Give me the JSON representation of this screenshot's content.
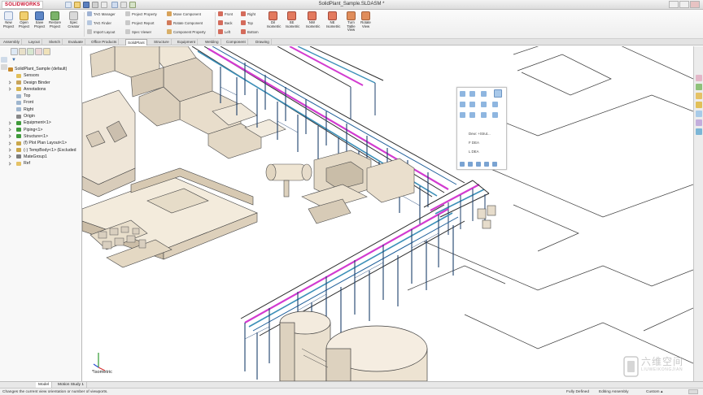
{
  "app": {
    "brand": "SOLIDWORKS",
    "window_title": "SolidPlant_Sample.SLDASM *"
  },
  "ribbon": {
    "buttons": [
      {
        "label": "New Project",
        "icon": "new-project-icon"
      },
      {
        "label": "Open Project",
        "icon": "open-project-icon"
      },
      {
        "label": "Save Project",
        "icon": "save-project-icon"
      },
      {
        "label": "Restore Project",
        "icon": "restore-project-icon"
      },
      {
        "label": "Spec Creator",
        "icon": "spec-creator-icon"
      }
    ],
    "column1": [
      "TAG Manager",
      "TAG Finder",
      "Import Layout"
    ],
    "column2": [
      "Project Property",
      "Project Report",
      "Spec Viewer"
    ],
    "column3": [
      "Move Component",
      "Rotate Component",
      "Component Property"
    ],
    "view_list1": [
      "Front",
      "Back",
      "Left"
    ],
    "view_list2": [
      "Right",
      "Top",
      "Bottom"
    ],
    "view_buttons": [
      {
        "label": "Dil Isometric"
      },
      {
        "label": "SE Isometric"
      },
      {
        "label": "NW Isometric"
      },
      {
        "label": "NE Isometric"
      },
      {
        "label": "Turn Table View"
      },
      {
        "label": "Rotate View"
      }
    ]
  },
  "command_tabs": [
    "Assembly",
    "Layout",
    "Sketch",
    "Evaluate",
    "Office Products",
    "SolidPlant",
    "Structure",
    "Equipment",
    "Welding",
    "Component",
    "Drawing"
  ],
  "active_command_tab": "SolidPlant",
  "feature_tree": {
    "items": [
      {
        "label": "SolidPlant_Sample  (default)",
        "icon": "assembly-icon",
        "color": "#c98a2c"
      },
      {
        "label": "Sensors",
        "icon": "sensors-folder-icon",
        "color": "#e2c05a"
      },
      {
        "label": "Design Binder",
        "icon": "design-binder-icon",
        "color": "#c7a35a"
      },
      {
        "label": "Annotations",
        "icon": "annotations-icon",
        "color": "#d8b44e"
      },
      {
        "label": "Top",
        "icon": "plane-icon",
        "color": "#9fb6cf"
      },
      {
        "label": "Front",
        "icon": "plane-icon",
        "color": "#9fb6cf"
      },
      {
        "label": "Right",
        "icon": "plane-icon",
        "color": "#9fb6cf"
      },
      {
        "label": "Origin",
        "icon": "origin-icon",
        "color": "#888888"
      },
      {
        "label": "Equipment<1>",
        "icon": "subassembly-icon",
        "color": "#3f9a3a"
      },
      {
        "label": "Piping<1>",
        "icon": "subassembly-icon",
        "color": "#3f9a3a"
      },
      {
        "label": "Structure<1>",
        "icon": "subassembly-icon",
        "color": "#3f9a3a"
      },
      {
        "label": "(f) Plot Plan Layout<1>",
        "icon": "part-icon",
        "color": "#c9a64a"
      },
      {
        "label": "(-) TempBody<1> (Excluded",
        "icon": "part-icon",
        "color": "#c9a64a"
      },
      {
        "label": "MateGroup1",
        "icon": "mates-icon",
        "color": "#7d7d7d"
      },
      {
        "label": "Ref",
        "icon": "folder-icon",
        "color": "#e5c266"
      }
    ]
  },
  "hud": {
    "menu_items": [
      "Dew: +Strut...",
      "F DEA",
      "L DEA"
    ]
  },
  "viewport": {
    "view_name": "*Isometric"
  },
  "bottom_tabs": [
    "Model",
    "Motion Study 1"
  ],
  "status": {
    "message": "Changes the current view orientation or number of viewports.",
    "definition": "Fully Defined",
    "mode": "Editing Assembly",
    "units": "Custom"
  },
  "watermark": {
    "cn": "六维空间",
    "en": "LIUWEIKONGJIAN"
  }
}
